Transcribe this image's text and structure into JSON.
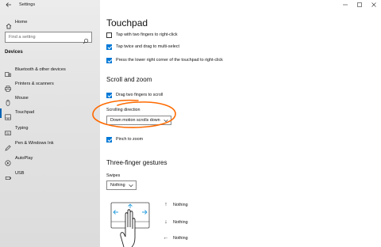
{
  "window": {
    "title": "Settings"
  },
  "sidebar": {
    "home_label": "Home",
    "search_placeholder": "Find a setting",
    "section_header": "Devices",
    "items": [
      {
        "label": "Bluetooth & other devices",
        "icon": "bluetooth-icon"
      },
      {
        "label": "Printers & scanners",
        "icon": "printer-icon"
      },
      {
        "label": "Mouse",
        "icon": "mouse-icon"
      },
      {
        "label": "Touchpad",
        "icon": "touchpad-icon",
        "selected": true
      },
      {
        "label": "Typing",
        "icon": "keyboard-icon"
      },
      {
        "label": "Pen & Windows Ink",
        "icon": "pen-icon"
      },
      {
        "label": "AutoPlay",
        "icon": "autoplay-icon"
      },
      {
        "label": "USB",
        "icon": "usb-icon"
      }
    ]
  },
  "main": {
    "title": "Touchpad",
    "taps": [
      {
        "label": "Tap with two fingers to right-click",
        "checked": false
      },
      {
        "label": "Tap twice and drag to multi-select",
        "checked": true
      },
      {
        "label": "Press the lower right corner of the touchpad to right-click",
        "checked": true
      }
    ],
    "scroll_zoom": {
      "heading": "Scroll and zoom",
      "drag_two_fingers": {
        "label": "Drag two fingers to scroll",
        "checked": true
      },
      "direction_label": "Scrolling direction",
      "direction_value": "Down motion scrolls down",
      "pinch": {
        "label": "Pinch to zoom",
        "checked": true
      }
    },
    "three_finger": {
      "heading": "Three-finger gestures",
      "swipes_label": "Swipes",
      "swipes_value": "Nothing",
      "gestures": [
        {
          "arrow": "↑",
          "label": "Nothing"
        },
        {
          "arrow": "↓",
          "label": "Nothing"
        },
        {
          "arrow": "←",
          "label": "Nothing"
        }
      ]
    }
  },
  "colors": {
    "accent": "#0078d7",
    "annotation": "#ff6a00"
  }
}
